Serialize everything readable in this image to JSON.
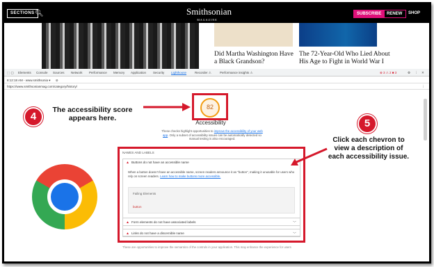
{
  "site": {
    "sections_label": "SECTIONS",
    "logo": "Smithsonian",
    "logo_sub": "MAGAZINE",
    "subscribe_label": "SUBSCRIBE",
    "renew_label": "RENEW",
    "shop_label": "SHOP",
    "headline_1": "Did Martha Washington Have a Black Grandson?",
    "headline_2": "The 72-Year-Old Who Lied About His Age to Fight in World War I"
  },
  "devtools": {
    "tabs": [
      "Elements",
      "Console",
      "Sources",
      "Network",
      "Performance",
      "Memory",
      "Application",
      "Security",
      "Lighthouse",
      "Recorder ⚠",
      "Performance insights ⚠"
    ],
    "report_time": "8:12:18 AM - www.smithsonia ▾",
    "url": "https://www.smithsonianmag.com/category/history/",
    "warning_counts": "⊗ 3  ⚠ 2  ■ 3"
  },
  "report": {
    "score": "82",
    "category_title": "Accessibility",
    "description_1": "These checks highlight opportunities to ",
    "description_link": "improve the accessibility of your web app",
    "description_2": ". Only a subset of accessibility issues can be automatically detected so manual testing is also encouraged.",
    "group_title": "NAMES AND LABELS",
    "audits": [
      {
        "title": "Buttons do not have an accessible name"
      },
      {
        "title": "Form elements do not have associated labels"
      },
      {
        "title": "Links do not have a discernible name"
      }
    ],
    "detail_text": "When a button doesn't have an accessible name, screen readers announce it as \"button\", making it unusable for users who rely on screen readers. ",
    "detail_link": "Learn how to make buttons more accessible.",
    "failing_header": "Failing Elements",
    "failing_node": "button",
    "footer_text": "These are opportunities to improve the semantics of the controls in your application. This may enhance the experience for users"
  },
  "annotations": {
    "step4_number": "4",
    "step4_text": "The accessibility score appears here.",
    "step5_number": "5",
    "step5_text": "Click each chevron to view a description of each accessibility issue."
  },
  "colors": {
    "accent_red": "#d5182b",
    "score_orange": "#f39c12",
    "subscribe_pink": "#e0107a"
  }
}
